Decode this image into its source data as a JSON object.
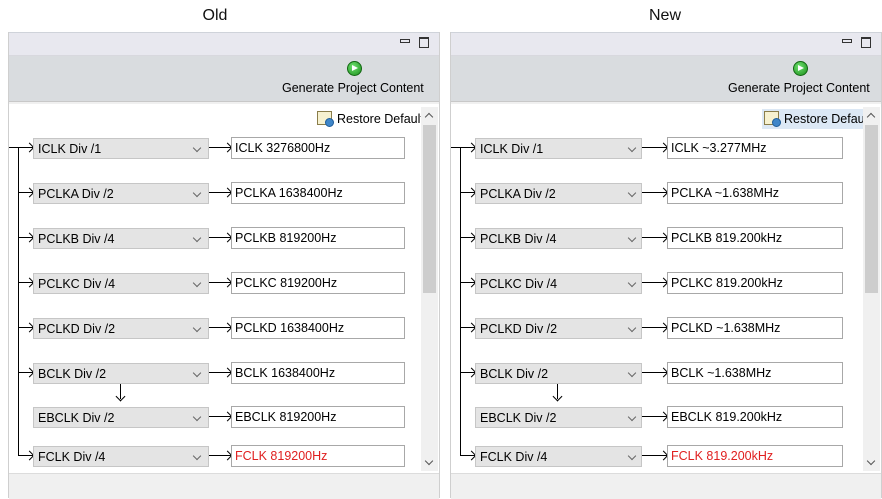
{
  "old": {
    "heading": "Old",
    "toolbar": {
      "generate_label": "Generate Project Content",
      "restore_label": "Restore Defaults"
    },
    "rows": [
      {
        "select": "ICLK Div /1",
        "output": "ICLK 3276800Hz"
      },
      {
        "select": "PCLKA Div /2",
        "output": "PCLKA 1638400Hz"
      },
      {
        "select": "PCLKB Div /4",
        "output": "PCLKB 819200Hz"
      },
      {
        "select": "PCLKC Div /4",
        "output": "PCLKC 819200Hz"
      },
      {
        "select": "PCLKD Div /2",
        "output": "PCLKD 1638400Hz"
      },
      {
        "select": "BCLK Div /2",
        "output": "BCLK 1638400Hz"
      },
      {
        "select": "EBCLK Div /2",
        "output": "EBCLK 819200Hz"
      },
      {
        "select": "FCLK Div /4",
        "output": "FCLK 819200Hz"
      }
    ]
  },
  "new": {
    "heading": "New",
    "toolbar": {
      "generate_label": "Generate Project Content",
      "restore_label": "Restore Defaults"
    },
    "rows": [
      {
        "select": "ICLK Div /1",
        "output": "ICLK ~3.277MHz"
      },
      {
        "select": "PCLKA Div /2",
        "output": "PCLKA ~1.638MHz"
      },
      {
        "select": "PCLKB Div /4",
        "output": "PCLKB 819.200kHz"
      },
      {
        "select": "PCLKC Div /4",
        "output": "PCLKC 819.200kHz"
      },
      {
        "select": "PCLKD Div /2",
        "output": "PCLKD ~1.638MHz"
      },
      {
        "select": "BCLK Div /2",
        "output": "BCLK ~1.638MHz"
      },
      {
        "select": "EBCLK Div /2",
        "output": "EBCLK 819.200kHz"
      },
      {
        "select": "FCLK Div /4",
        "output": "FCLK 819.200kHz"
      }
    ]
  },
  "colors": {
    "error_text": "#e02020",
    "restore_highlight": "#dce8f5",
    "generate_icon": "#1b8f1b"
  },
  "icons": {
    "generate": "green-play-icon",
    "restore": "restore-defaults-icon",
    "minimize": "minimize-icon",
    "maximize": "maximize-icon"
  }
}
